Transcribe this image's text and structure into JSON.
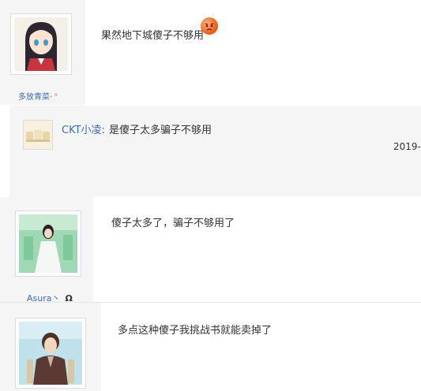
{
  "posts": [
    {
      "username": "多放青菜·",
      "badge": "°",
      "text": "果然地下城傻子不够用",
      "emoji_icon": "angry-face-emoji"
    },
    {
      "username": "Asura丶",
      "badge": "Ω",
      "text": "傻子太多了，骗子不够用了"
    },
    {
      "username": "",
      "text": "多点这种傻子我挑战书就能卖掉了"
    }
  ],
  "reply": {
    "username": "CKT小凌:",
    "text": "是傻子太多骗子不够用",
    "timestamp": "2019-"
  },
  "colors": {
    "link": "#3c6cb4",
    "panel": "#f5f5f5",
    "text": "#333333"
  }
}
